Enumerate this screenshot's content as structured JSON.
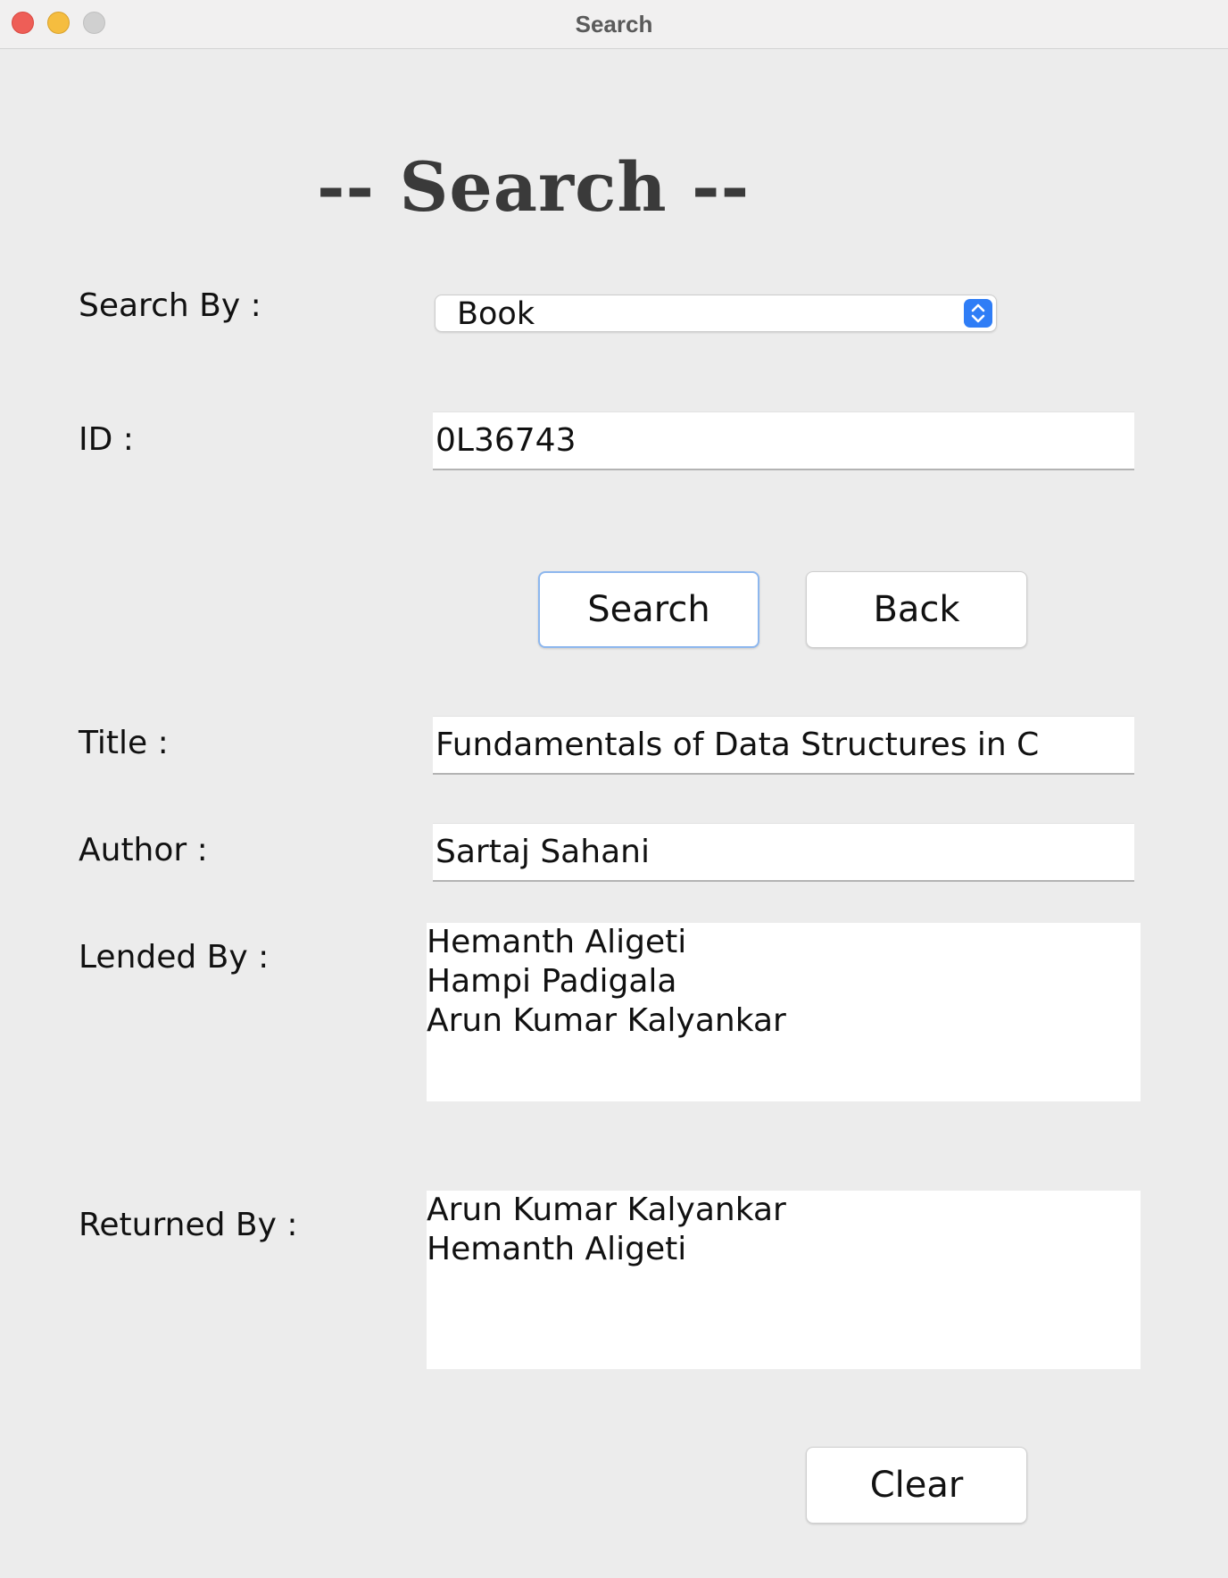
{
  "window": {
    "title": "Search"
  },
  "heading": "-- Search --",
  "search_by": {
    "label": "Search By :",
    "selected": "Book"
  },
  "id": {
    "label": "ID :",
    "value": "0L36743"
  },
  "buttons": {
    "search": "Search",
    "back": "Back",
    "clear": "Clear"
  },
  "title": {
    "label": "Title :",
    "value": "Fundamentals of Data Structures in C"
  },
  "author": {
    "label": "Author :",
    "value": "Sartaj Sahani"
  },
  "lended_by": {
    "label": "Lended By :",
    "names": [
      "Hemanth Aligeti",
      "Hampi Padigala",
      "Arun Kumar Kalyankar"
    ]
  },
  "returned_by": {
    "label": "Returned By :",
    "names": [
      "Arun Kumar Kalyankar",
      "Hemanth Aligeti"
    ]
  },
  "colors": {
    "accent": "#2f7df6",
    "focus_ring": "#8db7ee",
    "background": "#ececec"
  },
  "icons": {
    "select_arrows": "up-down-chevron-icon"
  }
}
